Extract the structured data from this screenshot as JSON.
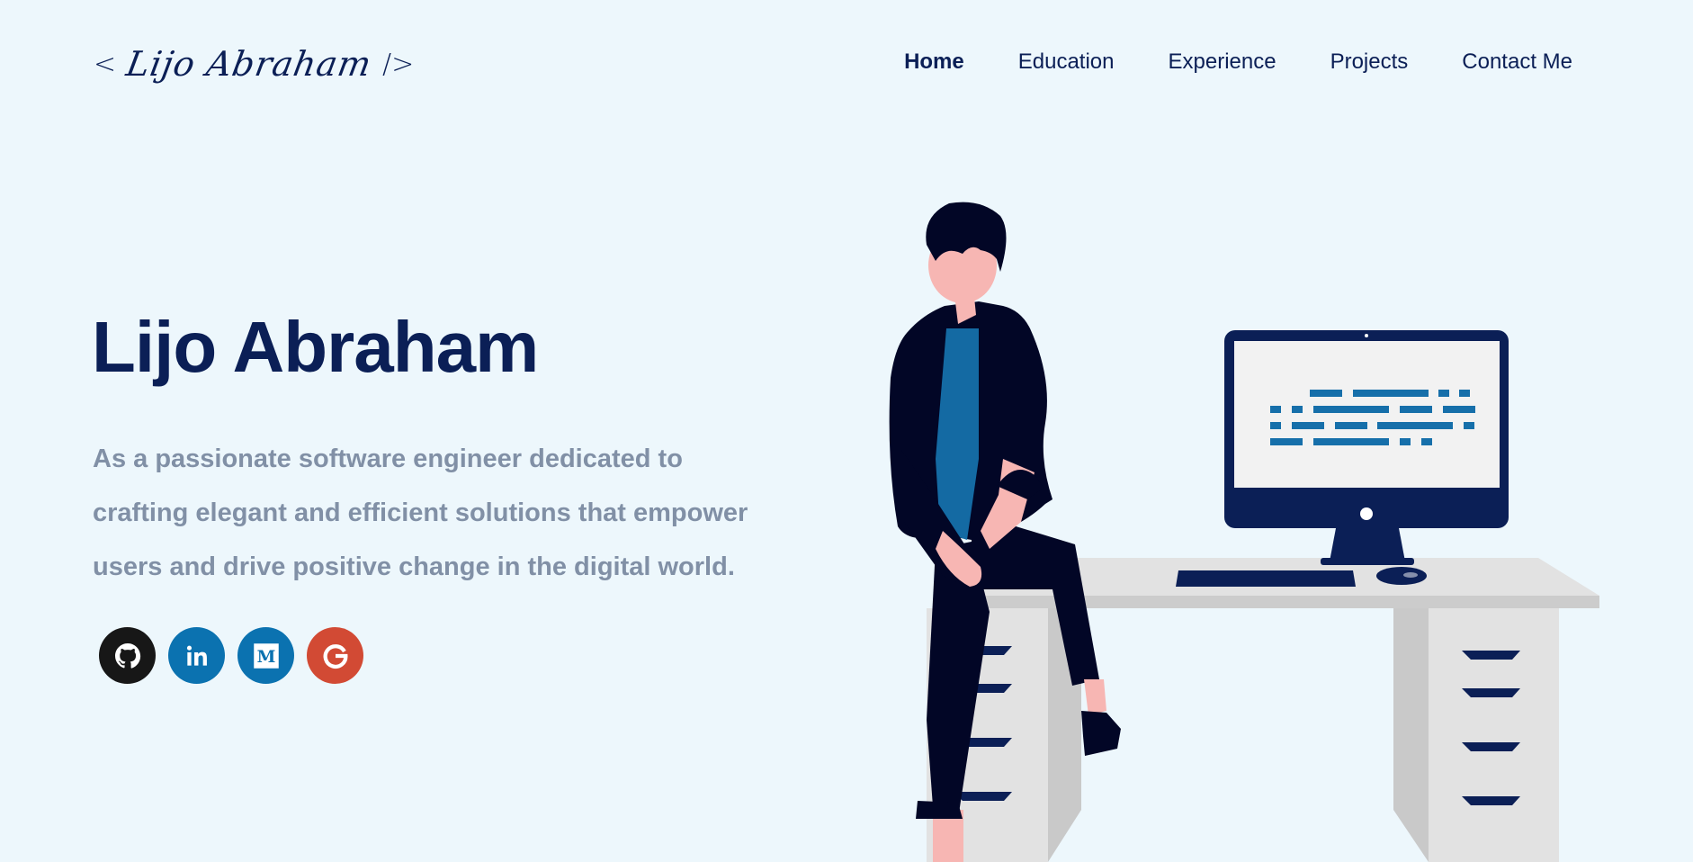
{
  "header": {
    "logo": {
      "open_bracket": "<",
      "signature": "Lijo Abraham",
      "close_bracket": "/>"
    },
    "nav": [
      {
        "label": "Home",
        "active": true
      },
      {
        "label": "Education",
        "active": false
      },
      {
        "label": "Experience",
        "active": false
      },
      {
        "label": "Projects",
        "active": false
      },
      {
        "label": "Contact Me",
        "active": false
      }
    ]
  },
  "hero": {
    "title": "Lijo Abraham",
    "description": "As a passionate software engineer dedicated to crafting elegant and efficient solutions that empower users and drive positive change in the digital world."
  },
  "socials": [
    {
      "name": "github",
      "icon": "github-icon",
      "color": "#171717"
    },
    {
      "name": "linkedin",
      "icon": "linkedin-icon",
      "color": "#0b72b0"
    },
    {
      "name": "medium",
      "icon": "medium-icon",
      "color": "#0b72b0"
    },
    {
      "name": "google",
      "icon": "google-icon",
      "color": "#d24a34"
    }
  ],
  "colors": {
    "background": "#edf7fc",
    "primary": "#0b1f56",
    "muted_text": "#8190a6"
  }
}
